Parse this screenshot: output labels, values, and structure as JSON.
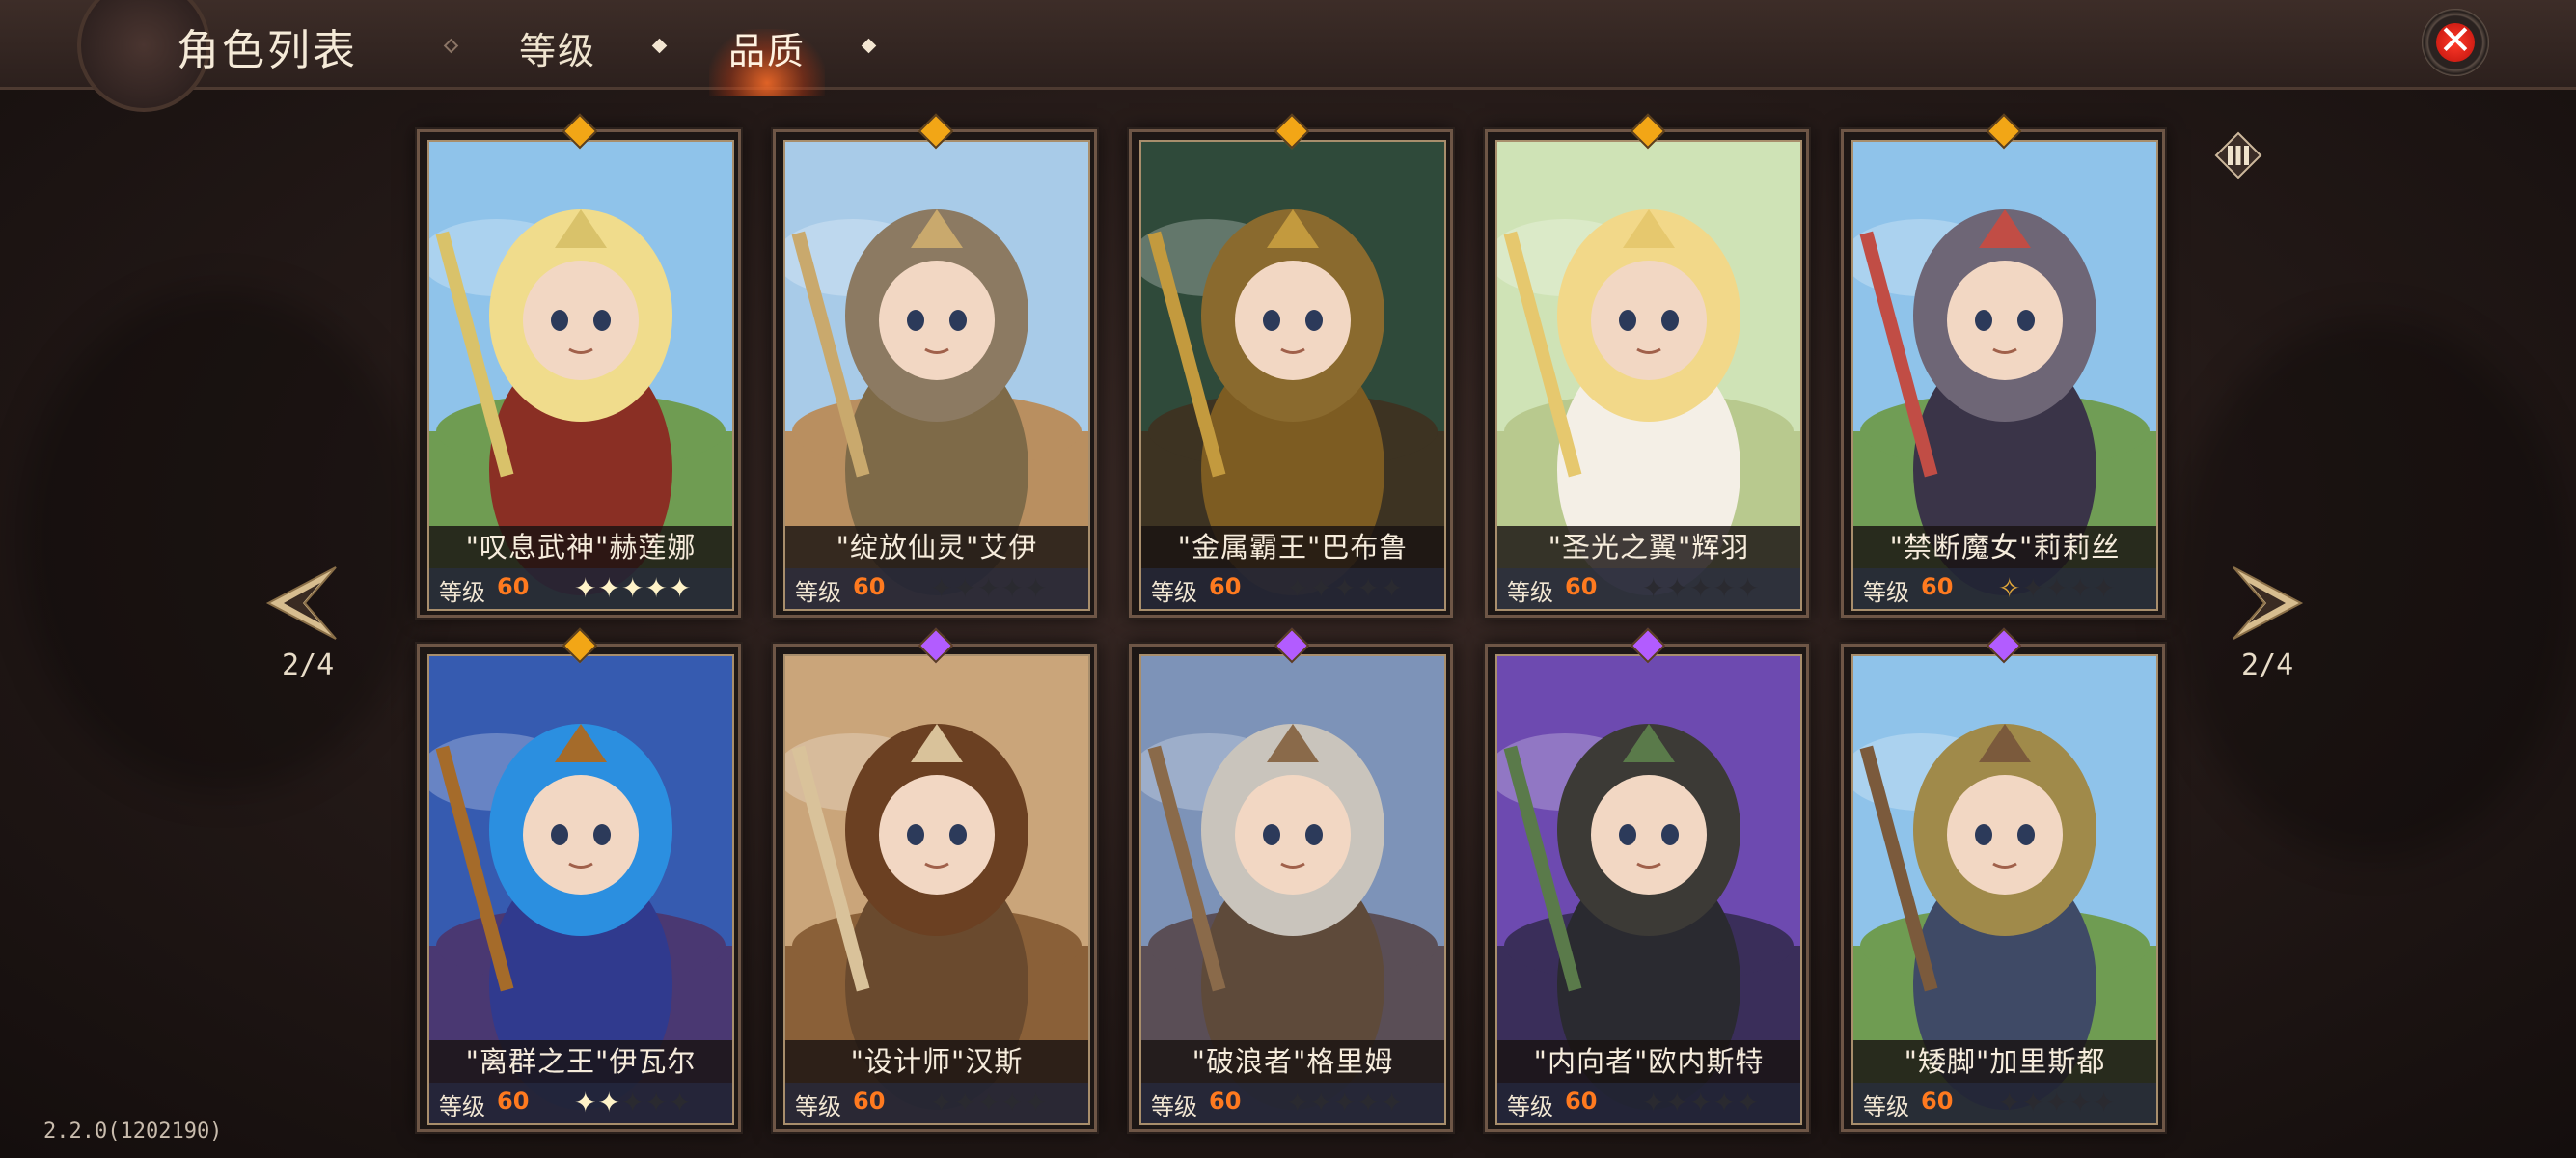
{
  "header": {
    "title": "角色列表",
    "tabs": [
      {
        "label": "等级",
        "active": false
      },
      {
        "label": "品质",
        "active": true
      }
    ]
  },
  "page": {
    "indicator_left": "2/4",
    "indicator_right": "2/4"
  },
  "version": "2.2.0(1202190)",
  "colors": {
    "level_value": "#ff7a1f",
    "gem_gold": "#f2a616",
    "gem_purple": "#b25cff",
    "close_red": "#e02418"
  },
  "characters": [
    {
      "name": "\"叹息武神\"赫莲娜",
      "level_label": "等级",
      "level": "60",
      "stars_lit": 5,
      "stars_half": 0,
      "gem": "gold"
    },
    {
      "name": "\"绽放仙灵\"艾伊",
      "level_label": "等级",
      "level": "60",
      "stars_lit": 0,
      "stars_half": 0,
      "gem": "gold"
    },
    {
      "name": "\"金属霸王\"巴布鲁",
      "level_label": "等级",
      "level": "60",
      "stars_lit": 0,
      "stars_half": 0,
      "gem": "gold"
    },
    {
      "name": "\"圣光之翼\"辉羽",
      "level_label": "等级",
      "level": "60",
      "stars_lit": 0,
      "stars_half": 0,
      "gem": "gold"
    },
    {
      "name": "\"禁断魔女\"莉莉丝",
      "level_label": "等级",
      "level": "60",
      "stars_lit": 0,
      "stars_half": 1,
      "gem": "gold"
    },
    {
      "name": "\"离群之王\"伊瓦尔",
      "level_label": "等级",
      "level": "60",
      "stars_lit": 2,
      "stars_half": 0,
      "gem": "gold"
    },
    {
      "name": "\"设计师\"汉斯",
      "level_label": "等级",
      "level": "60",
      "stars_lit": 0,
      "stars_half": 0,
      "gem": "purple"
    },
    {
      "name": "\"破浪者\"格里姆",
      "level_label": "等级",
      "level": "60",
      "stars_lit": 0,
      "stars_half": 0,
      "gem": "purple"
    },
    {
      "name": "\"内向者\"欧内斯特",
      "level_label": "等级",
      "level": "60",
      "stars_lit": 0,
      "stars_half": 0,
      "gem": "purple"
    },
    {
      "name": "\"矮脚\"加里斯都",
      "level_label": "等级",
      "level": "60",
      "stars_lit": 0,
      "stars_half": 0,
      "gem": "purple"
    }
  ]
}
